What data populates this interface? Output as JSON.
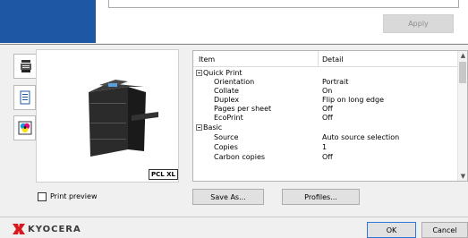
{
  "apply_label": "Apply",
  "side_tabs": [
    {
      "icon": "printer-settings-icon"
    },
    {
      "icon": "document-icon"
    },
    {
      "icon": "color-icon"
    }
  ],
  "printer": {
    "pdl_badge": "PCL XL"
  },
  "table": {
    "col_item": "Item",
    "col_detail": "Detail",
    "groups": [
      {
        "name": "Quick Print",
        "rows": [
          {
            "item": "Orientation",
            "detail": "Portrait"
          },
          {
            "item": "Collate",
            "detail": "On"
          },
          {
            "item": "Duplex",
            "detail": "Flip on long edge"
          },
          {
            "item": "Pages per sheet",
            "detail": "Off"
          },
          {
            "item": "EcoPrint",
            "detail": "Off"
          }
        ]
      },
      {
        "name": "Basic",
        "rows": [
          {
            "item": "Source",
            "detail": "Auto source selection"
          },
          {
            "item": "Copies",
            "detail": "1"
          },
          {
            "item": "Carbon copies",
            "detail": "Off"
          }
        ]
      }
    ]
  },
  "print_preview_label": "Print preview",
  "save_as_label": "Save As...",
  "profiles_label": "Profiles...",
  "brand": "KYOCERA",
  "ok_label": "OK",
  "cancel_label": "Cancel",
  "colors": {
    "brand_red": "#d71920",
    "header_blue": "#1e58a5",
    "ok_border": "#2f7ad8"
  }
}
